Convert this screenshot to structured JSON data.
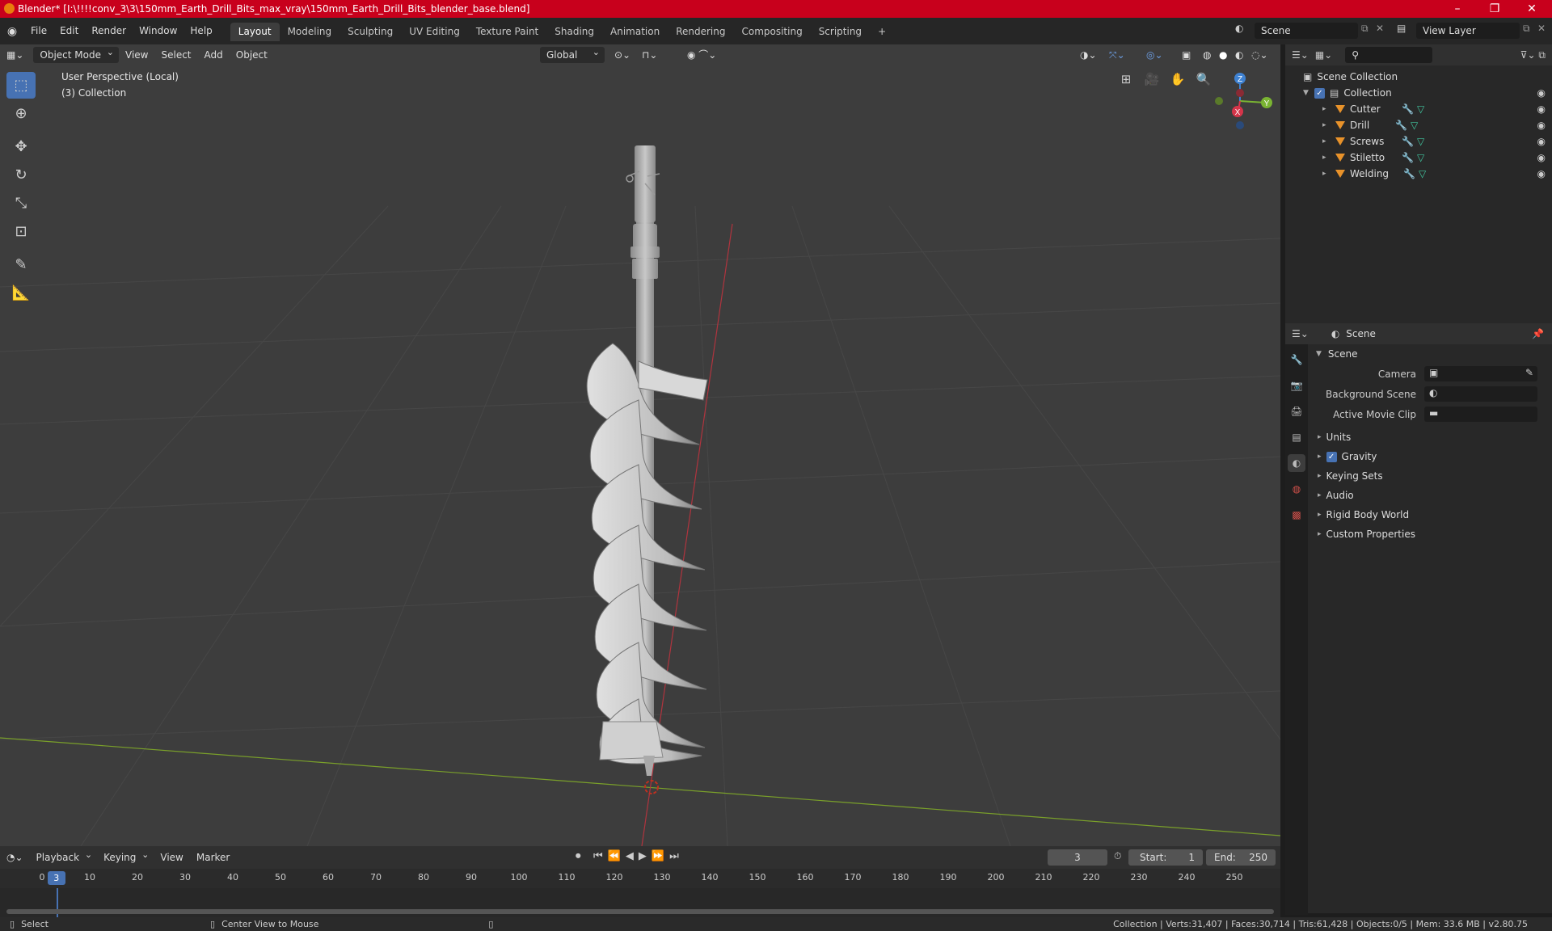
{
  "titlebar": {
    "title": "Blender* [I:\\!!!!conv_3\\3\\150mm_Earth_Drill_Bits_max_vray\\150mm_Earth_Drill_Bits_blender_base.blend]",
    "minimize": "–",
    "maximize": "❐",
    "close": "✕"
  },
  "menu": [
    "File",
    "Edit",
    "Render",
    "Window",
    "Help"
  ],
  "workspaces": [
    "Layout",
    "Modeling",
    "Sculpting",
    "UV Editing",
    "Texture Paint",
    "Shading",
    "Animation",
    "Rendering",
    "Compositing",
    "Scripting"
  ],
  "active_workspace": "Layout",
  "scene_field": "Scene",
  "viewlayer_field": "View Layer",
  "viewport": {
    "mode": "Object Mode",
    "menus": [
      "View",
      "Select",
      "Add",
      "Object"
    ],
    "transform_orientation": "Global",
    "perspective_label": "User Perspective (Local)",
    "collection_label": "(3) Collection",
    "gizmo": {
      "z": "Z",
      "y": "Y",
      "x": "X"
    }
  },
  "outliner": {
    "root": "Scene Collection",
    "collection": "Collection",
    "objects": [
      "Cutter",
      "Drill",
      "Screws",
      "Stiletto",
      "Welding"
    ]
  },
  "properties": {
    "context": "Scene",
    "section": "Scene",
    "rows": [
      {
        "label": "Camera"
      },
      {
        "label": "Background Scene"
      },
      {
        "label": "Active Movie Clip"
      }
    ],
    "subsections": [
      "Units",
      "Gravity",
      "Keying Sets",
      "Audio",
      "Rigid Body World",
      "Custom Properties"
    ]
  },
  "timeline": {
    "menus": [
      "Playback",
      "Keying",
      "View",
      "Marker"
    ],
    "current_frame": "3",
    "start_label": "Start:",
    "start_value": "1",
    "end_label": "End:",
    "end_value": "250",
    "ticks": [
      "0",
      "10",
      "20",
      "30",
      "40",
      "50",
      "60",
      "70",
      "80",
      "90",
      "100",
      "110",
      "120",
      "130",
      "140",
      "150",
      "160",
      "170",
      "180",
      "190",
      "200",
      "210",
      "220",
      "230",
      "240",
      "250"
    ],
    "playhead_value": 3
  },
  "statusbar": {
    "select": "Select",
    "center_view": "Center View to Mouse",
    "stats": "Collection | Verts:31,407 | Faces:30,714 | Tris:61,428 | Objects:0/5 | Mem: 33.6 MB | v2.80.75"
  }
}
